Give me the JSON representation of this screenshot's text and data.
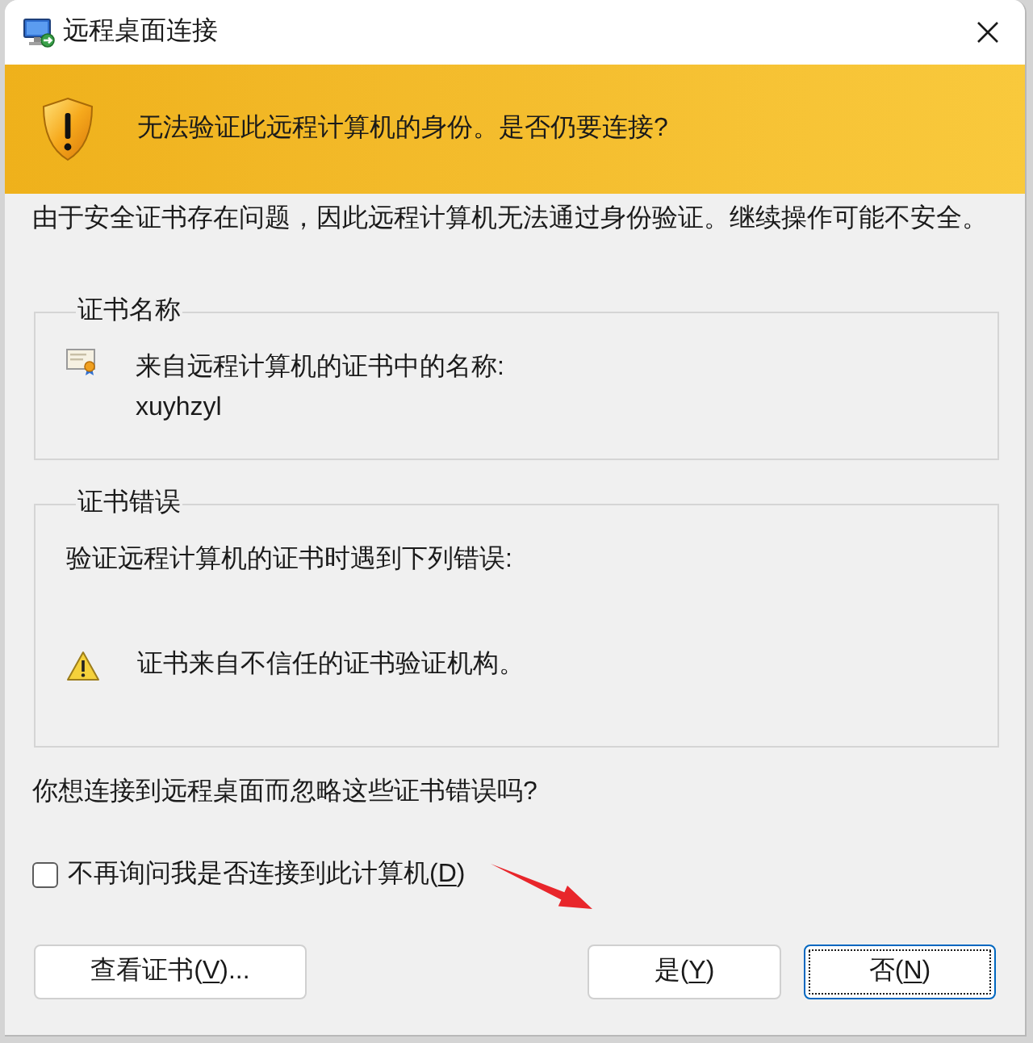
{
  "window": {
    "title": "远程桌面连接"
  },
  "banner": {
    "message": "无法验证此远程计算机的身份。是否仍要连接?"
  },
  "description": "由于安全证书存在问题，因此远程计算机无法通过身份验证。继续操作可能不安全。",
  "certificate_name": {
    "title": "证书名称",
    "label": "来自远程计算机的证书中的名称:",
    "value": "xuyhzyl"
  },
  "certificate_errors": {
    "title": "证书错误",
    "intro": "验证远程计算机的证书时遇到下列错误:",
    "errors": [
      "证书来自不信任的证书验证机构。"
    ]
  },
  "question": "你想连接到远程桌面而忽略这些证书错误吗?",
  "dont_ask_checkbox": {
    "label_start": "不再询问我是否连接到此计算机(",
    "access_key": "D",
    "label_end": ")",
    "checked": false
  },
  "buttons": [
    {
      "label_start": "查看证书(",
      "access_key": "V",
      "label_end": ")...",
      "focused": false
    },
    {
      "label_start": "是(",
      "access_key": "Y",
      "label_end": ")",
      "focused": false
    },
    {
      "label_start": "否(",
      "access_key": "N",
      "label_end": ")",
      "focused": true
    }
  ]
}
